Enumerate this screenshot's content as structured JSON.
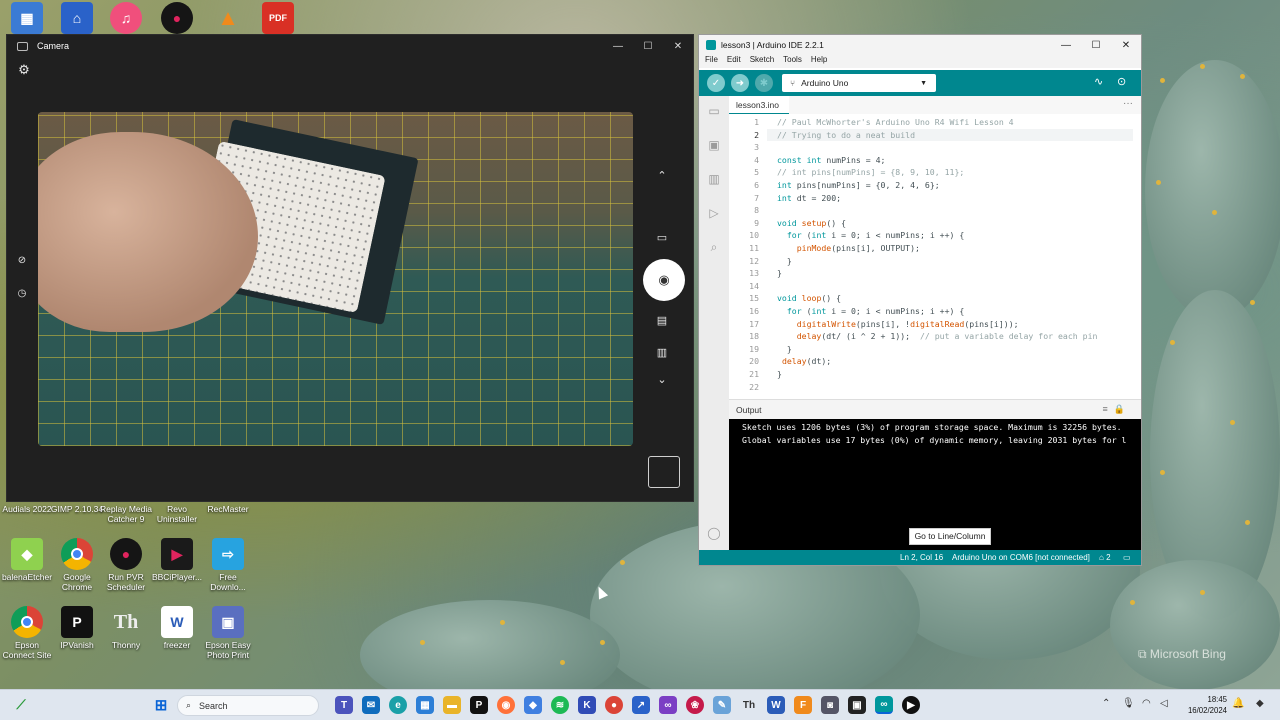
{
  "desktop": {
    "top_icons": [
      {
        "name": "control-panel-icon",
        "color": "#3b7bd4"
      },
      {
        "name": "remote-desktop-icon",
        "color": "#2a62c9"
      },
      {
        "name": "itunes-icon",
        "color": "#f04f7c"
      },
      {
        "name": "rec-icon",
        "color": "#151515"
      },
      {
        "name": "vlc-icon",
        "color": "#f08a1c"
      },
      {
        "name": "pdf-icon",
        "color": "#d93025"
      }
    ],
    "row1_labels": [
      "Audials 2022",
      "GIMP 2.10.34",
      "Replay Media Catcher 9",
      "Revo Uninstaller",
      "RecMaster"
    ],
    "row2": [
      {
        "label": "balenaEtcher",
        "icon": "balena-etcher-icon",
        "color": "#8fd14f"
      },
      {
        "label": "Google Chrome",
        "icon": "chrome-icon",
        "color": "#db4437"
      },
      {
        "label": "Run PVR Scheduler",
        "icon": "pvr-icon",
        "color": "#151515"
      },
      {
        "label": "BBCiPlayer...",
        "icon": "bbc-iplayer-icon",
        "color": "#1a1a1a"
      },
      {
        "label": "Free Downlo...",
        "icon": "download-icon",
        "color": "#27a3e0"
      }
    ],
    "row3": [
      {
        "label": "Epson Connect Site",
        "icon": "chrome-icon",
        "color": "#db4437"
      },
      {
        "label": "IPVanish",
        "icon": "ipvanish-icon",
        "color": "#111111"
      },
      {
        "label": "Thonny",
        "icon": "thonny-icon",
        "color": "#9aa0a6"
      },
      {
        "label": "freezer",
        "icon": "word-doc-icon",
        "color": "#2b5cb8"
      },
      {
        "label": "Epson Easy Photo Print",
        "icon": "epson-photo-icon",
        "color": "#5a6fc0"
      }
    ],
    "watermark": "Microsoft Bing"
  },
  "camera": {
    "title": "Camera",
    "settings_icon": "gear-icon",
    "side_controls": [
      "chevron-up-icon",
      "video-icon",
      "shutter-camera-icon",
      "document-icon",
      "barcode-icon",
      "chevron-down-icon"
    ],
    "left_controls": [
      "hdr-off-icon",
      "timer-off-icon"
    ]
  },
  "ide": {
    "title": "lesson3 | Arduino IDE 2.2.1",
    "menu": [
      "File",
      "Edit",
      "Sketch",
      "Tools",
      "Help"
    ],
    "board": "Arduino Uno",
    "tab": "lesson3.ino",
    "code": [
      {
        "n": "1",
        "t": "// Paul McWhorter's Arduino Uno R4 Wifi Lesson 4"
      },
      {
        "n": "2",
        "t": "// Trying to do a neat build"
      },
      {
        "n": "3",
        "t": ""
      },
      {
        "n": "4",
        "t": "const int numPins = 4;"
      },
      {
        "n": "5",
        "t": "// int pins[numPins] = {8, 9, 10, 11};"
      },
      {
        "n": "6",
        "t": "int pins[numPins] = {0, 2, 4, 6};"
      },
      {
        "n": "7",
        "t": "int dt = 200;"
      },
      {
        "n": "8",
        "t": ""
      },
      {
        "n": "9",
        "t": "void setup() {"
      },
      {
        "n": "10",
        "t": "  for (int i = 0; i < numPins; i ++) {"
      },
      {
        "n": "11",
        "t": "    pinMode(pins[i], OUTPUT);"
      },
      {
        "n": "12",
        "t": "  }"
      },
      {
        "n": "13",
        "t": "}"
      },
      {
        "n": "14",
        "t": ""
      },
      {
        "n": "15",
        "t": "void loop() {"
      },
      {
        "n": "16",
        "t": "  for (int i = 0; i < numPins; i ++) {"
      },
      {
        "n": "17",
        "t": "    digitalWrite(pins[i], !digitalRead(pins[i]));"
      },
      {
        "n": "18",
        "t": "    delay(dt/ (i ^ 2 + 1));  // put a variable delay for each pin"
      },
      {
        "n": "19",
        "t": "  }"
      },
      {
        "n": "20",
        "t": " delay(dt);"
      },
      {
        "n": "21",
        "t": "}"
      },
      {
        "n": "22",
        "t": ""
      }
    ],
    "output_label": "Output",
    "output_lines": [
      "Sketch uses 1206 bytes (3%) of program storage space. Maximum is 32256 bytes.",
      "Global variables use 17 bytes (0%) of dynamic memory, leaving 2031 bytes for l"
    ],
    "goto_button": "Go to Line/Column",
    "status": {
      "position": "Ln 2, Col 16",
      "port": "Arduino Uno on COM6 [not connected]",
      "notifications": "2"
    }
  },
  "taskbar": {
    "search_placeholder": "Search",
    "time": "18:45",
    "date": "16/02/2024",
    "apps": [
      "start-icon",
      "widget-icon",
      "teams-icon",
      "mail-icon",
      "edge-icon",
      "store-icon",
      "explorer-icon",
      "p-app-icon",
      "firefox-icon",
      "vscode-blue-icon",
      "spotify-icon",
      "kicad-icon",
      "chrome-icon",
      "remote-icon",
      "visual-studio-icon",
      "raspberry-icon",
      "notepad-icon",
      "thonny-icon",
      "word-icon",
      "fusion-icon",
      "camera-icon",
      "capture-icon",
      "arduino-icon",
      "media-player-icon"
    ]
  }
}
